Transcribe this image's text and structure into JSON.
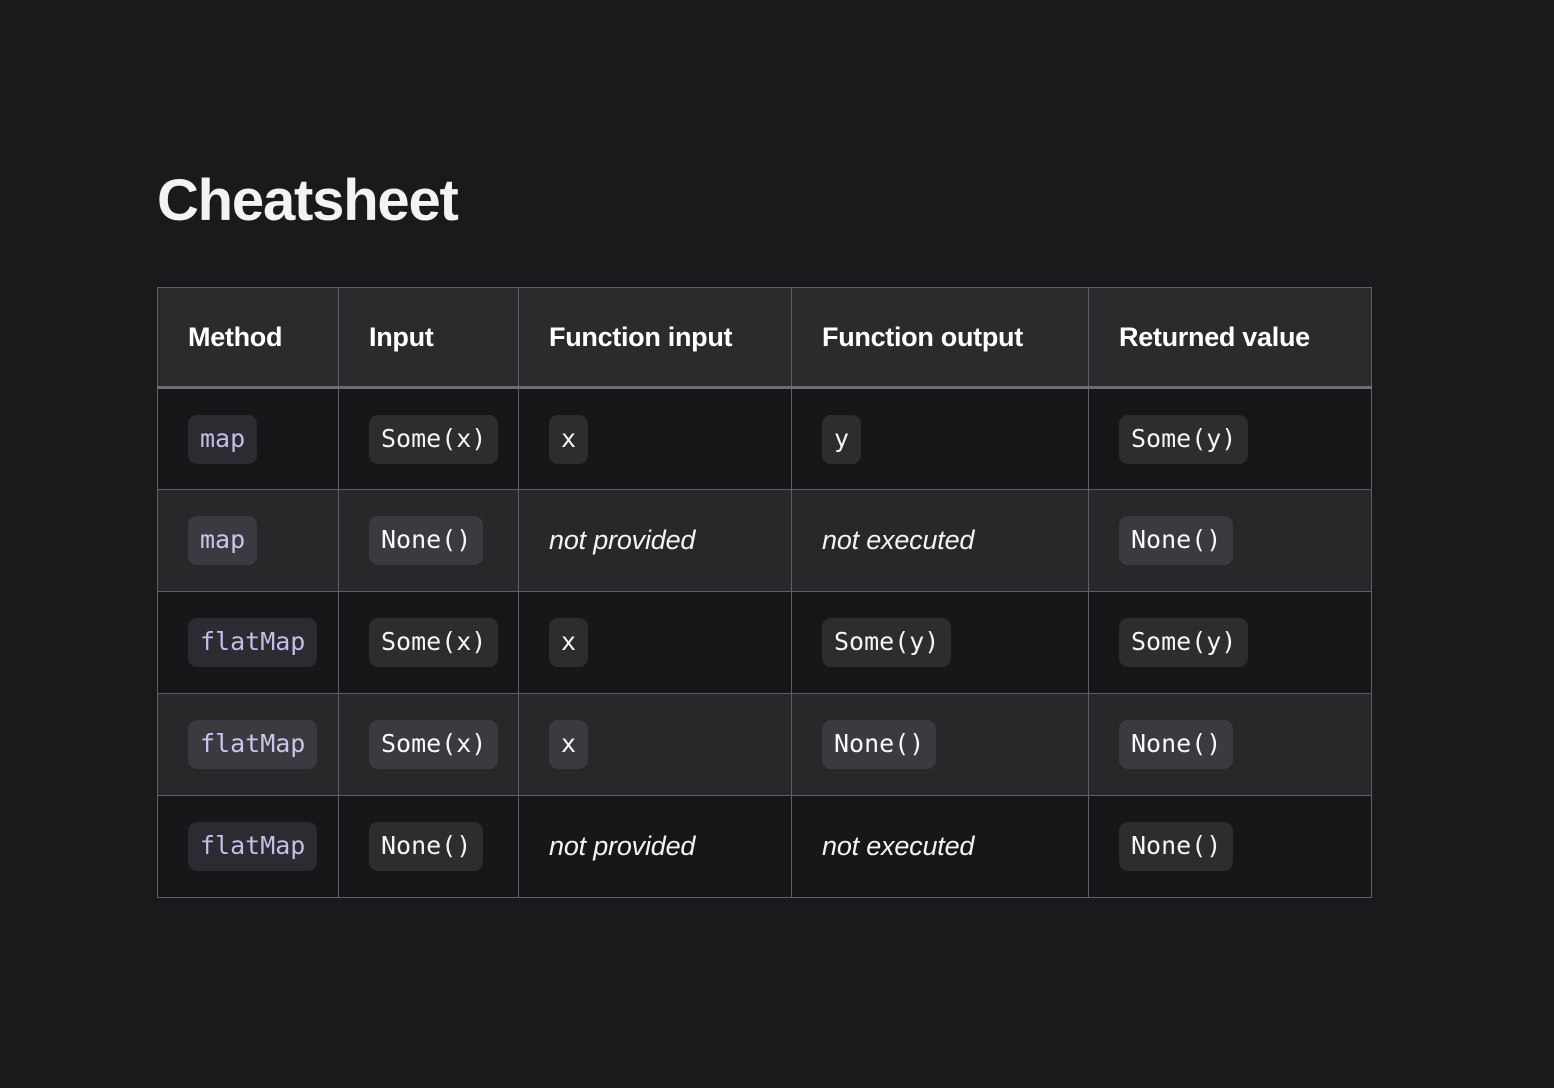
{
  "page": {
    "background_color": "#1a1a1d",
    "title": "Cheatsheet"
  },
  "theme": {
    "page_bg": "#1a1a1d",
    "header_bg": "#2b2b2e",
    "row_odd_bg": "#171719",
    "row_even_bg": "#28282b",
    "border_color": "#5a6068",
    "header_rule_color": "#6b7078",
    "text_color": "#f2f3f5",
    "method_chip_text": "#c8bbe8",
    "value_chip_text": "#f4f5f6"
  },
  "table": {
    "columns": [
      {
        "key": "method",
        "label": "Method"
      },
      {
        "key": "input",
        "label": "Input"
      },
      {
        "key": "fn_input",
        "label": "Function input"
      },
      {
        "key": "fn_output",
        "label": "Function output"
      },
      {
        "key": "returned",
        "label": "Returned value"
      }
    ],
    "rows": [
      {
        "method": {
          "text": "map",
          "style": "chip-method"
        },
        "input": {
          "text": "Some(x)",
          "style": "chip-value"
        },
        "fn_input": {
          "text": "x",
          "style": "chip-value"
        },
        "fn_output": {
          "text": "y",
          "style": "chip-value"
        },
        "returned": {
          "text": "Some(y)",
          "style": "chip-value"
        }
      },
      {
        "method": {
          "text": "map",
          "style": "chip-method"
        },
        "input": {
          "text": "None()",
          "style": "chip-value"
        },
        "fn_input": {
          "text": "not provided",
          "style": "italic"
        },
        "fn_output": {
          "text": "not executed",
          "style": "italic"
        },
        "returned": {
          "text": "None()",
          "style": "chip-value"
        }
      },
      {
        "method": {
          "text": "flatMap",
          "style": "chip-method"
        },
        "input": {
          "text": "Some(x)",
          "style": "chip-value"
        },
        "fn_input": {
          "text": "x",
          "style": "chip-value"
        },
        "fn_output": {
          "text": "Some(y)",
          "style": "chip-value"
        },
        "returned": {
          "text": "Some(y)",
          "style": "chip-value"
        }
      },
      {
        "method": {
          "text": "flatMap",
          "style": "chip-method"
        },
        "input": {
          "text": "Some(x)",
          "style": "chip-value"
        },
        "fn_input": {
          "text": "x",
          "style": "chip-value"
        },
        "fn_output": {
          "text": "None()",
          "style": "chip-value"
        },
        "returned": {
          "text": "None()",
          "style": "chip-value"
        }
      },
      {
        "method": {
          "text": "flatMap",
          "style": "chip-method"
        },
        "input": {
          "text": "None()",
          "style": "chip-value"
        },
        "fn_input": {
          "text": "not provided",
          "style": "italic"
        },
        "fn_output": {
          "text": "not executed",
          "style": "italic"
        },
        "returned": {
          "text": "None()",
          "style": "chip-value"
        }
      }
    ]
  }
}
